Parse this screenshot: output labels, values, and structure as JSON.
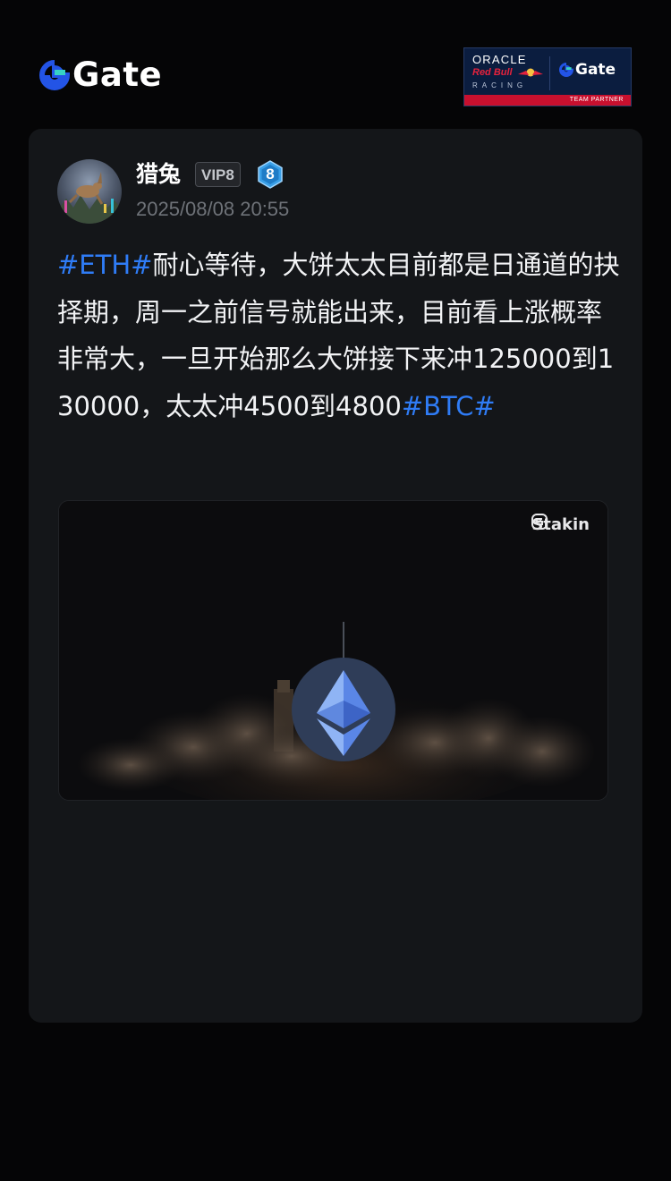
{
  "header": {
    "brand": "Gate",
    "partner": {
      "line1": "ORACLE",
      "line2": "Red Bull",
      "line3": "RACING",
      "gate": "Gate",
      "tag": "TEAM PARTNER"
    }
  },
  "post": {
    "username": "猎兔",
    "vip_badge": "VIP8",
    "level_badge": "8",
    "avatar_label": "猎兔",
    "timestamp": "2025/08/08 20:55",
    "hashtag_start": "#ETH#",
    "body": "耐心等待，大饼太太目前都是日通道的抉择期，周一之前信号就能出来，目前看上涨概率非常大，一旦开始那么大饼接下来冲125000到130000，太太冲4500到4800",
    "hashtag_end": "#BTC#",
    "media": {
      "watermark": "Stakin",
      "icon": "ethereum-icon"
    }
  },
  "colors": {
    "background": "#050506",
    "card": "#141619",
    "hashtag": "#2f7cf6",
    "brand_blue": "#2354e6",
    "level_badge": "#3aa0e8"
  }
}
